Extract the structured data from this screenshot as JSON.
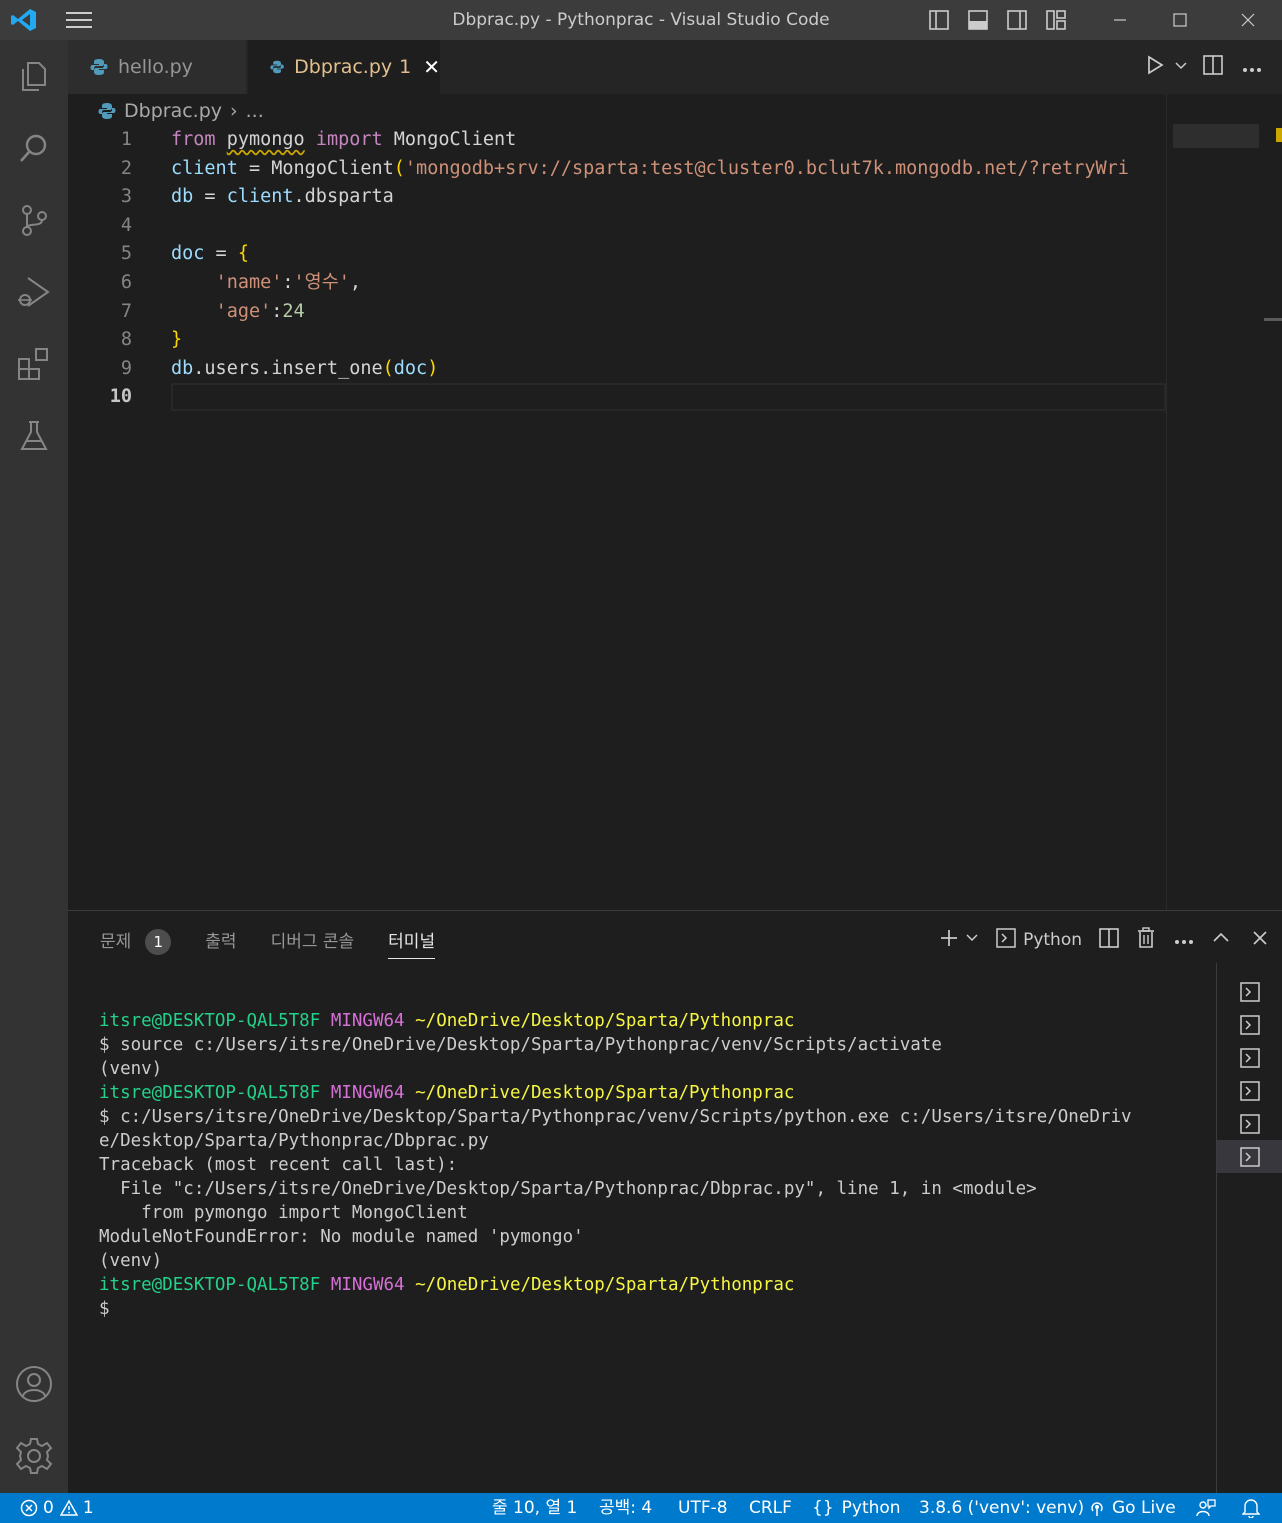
{
  "window": {
    "title": "Dbprac.py - Pythonprac - Visual Studio Code"
  },
  "tabs": [
    {
      "label": "hello.py",
      "active": false
    },
    {
      "label": "Dbprac.py",
      "problems": "1",
      "active": true
    }
  ],
  "breadcrumb": {
    "file": "Dbprac.py",
    "rest": "..."
  },
  "editor": {
    "line_numbers": [
      "1",
      "2",
      "3",
      "4",
      "5",
      "6",
      "7",
      "8",
      "9",
      "10"
    ],
    "current_line": "10",
    "lines": [
      [
        {
          "t": "from",
          "c": "kw"
        },
        {
          "t": " "
        },
        {
          "t": "pymongo",
          "c": "plain squiggle"
        },
        {
          "t": " "
        },
        {
          "t": "import",
          "c": "kw"
        },
        {
          "t": " "
        },
        {
          "t": "MongoClient",
          "c": "plain"
        }
      ],
      [
        {
          "t": "client",
          "c": "var"
        },
        {
          "t": " = "
        },
        {
          "t": "MongoClient",
          "c": "plain"
        },
        {
          "t": "(",
          "c": "br1"
        },
        {
          "t": "'mongodb+srv://sparta:test@cluster0.bclut7k.mongodb.net/?retryWri",
          "c": "str"
        }
      ],
      [
        {
          "t": "db",
          "c": "var"
        },
        {
          "t": " = "
        },
        {
          "t": "client",
          "c": "var"
        },
        {
          "t": ".dbsparta",
          "c": "plain"
        }
      ],
      [],
      [
        {
          "t": "doc",
          "c": "var"
        },
        {
          "t": " = "
        },
        {
          "t": "{",
          "c": "br1"
        }
      ],
      [
        {
          "t": "    "
        },
        {
          "t": "'name'",
          "c": "str"
        },
        {
          "t": ":"
        },
        {
          "t": "'영수'",
          "c": "str"
        },
        {
          "t": ","
        }
      ],
      [
        {
          "t": "    "
        },
        {
          "t": "'age'",
          "c": "str"
        },
        {
          "t": ":"
        },
        {
          "t": "24",
          "c": "num"
        }
      ],
      [
        {
          "t": "}",
          "c": "br1"
        }
      ],
      [
        {
          "t": "db",
          "c": "var"
        },
        {
          "t": ".users.insert_one",
          "c": "plain"
        },
        {
          "t": "(",
          "c": "br1"
        },
        {
          "t": "doc",
          "c": "var"
        },
        {
          "t": ")",
          "c": "br1"
        }
      ],
      []
    ]
  },
  "panel": {
    "tabs": [
      {
        "label": "문제",
        "badge": "1"
      },
      {
        "label": "출력"
      },
      {
        "label": "디버그 콘솔"
      },
      {
        "label": "터미널",
        "active": true
      }
    ],
    "terminal_profile": "Python",
    "terminal_lines": [
      [
        {
          "t": "itsre@DESKTOP-QAL5T8F",
          "c": "t-green"
        },
        {
          "t": " "
        },
        {
          "t": "MINGW64",
          "c": "t-purple"
        },
        {
          "t": " "
        },
        {
          "t": "~/OneDrive/Desktop/Sparta/Pythonprac",
          "c": "t-yellow"
        }
      ],
      [
        {
          "t": "$ source c:/Users/itsre/OneDrive/Desktop/Sparta/Pythonprac/venv/Scripts/activate"
        }
      ],
      [
        {
          "t": "(venv)"
        }
      ],
      [
        {
          "t": "itsre@DESKTOP-QAL5T8F",
          "c": "t-green"
        },
        {
          "t": " "
        },
        {
          "t": "MINGW64",
          "c": "t-purple"
        },
        {
          "t": " "
        },
        {
          "t": "~/OneDrive/Desktop/Sparta/Pythonprac",
          "c": "t-yellow"
        }
      ],
      [
        {
          "t": "$ c:/Users/itsre/OneDrive/Desktop/Sparta/Pythonprac/venv/Scripts/python.exe c:/Users/itsre/OneDriv"
        }
      ],
      [
        {
          "t": "e/Desktop/Sparta/Pythonprac/Dbprac.py"
        }
      ],
      [
        {
          "t": "Traceback (most recent call last):"
        }
      ],
      [
        {
          "t": "  File \"c:/Users/itsre/OneDrive/Desktop/Sparta/Pythonprac/Dbprac.py\", line 1, in <module>"
        }
      ],
      [
        {
          "t": "    from pymongo import MongoClient"
        }
      ],
      [
        {
          "t": "ModuleNotFoundError: No module named 'pymongo'"
        }
      ],
      [
        {
          "t": "(venv)"
        }
      ],
      [
        {
          "t": "itsre@DESKTOP-QAL5T8F",
          "c": "t-green"
        },
        {
          "t": " "
        },
        {
          "t": "MINGW64",
          "c": "t-purple"
        },
        {
          "t": " "
        },
        {
          "t": "~/OneDrive/Desktop/Sparta/Pythonprac",
          "c": "t-yellow"
        }
      ],
      [
        {
          "t": "$"
        }
      ]
    ],
    "terminal_instances": 6
  },
  "statusbar": {
    "errors": "0",
    "warnings": "1",
    "position": "줄 10, 열 1",
    "indent": "공백: 4",
    "encoding": "UTF-8",
    "eol": "CRLF",
    "language": "Python",
    "interpreter": "3.8.6 ('venv': venv)",
    "golive": "Go Live"
  },
  "colors": {
    "accent": "#007acc",
    "activity_bar": "#333333",
    "editor_bg": "#1e1e1e",
    "modified_tab": "#e2c08d"
  }
}
